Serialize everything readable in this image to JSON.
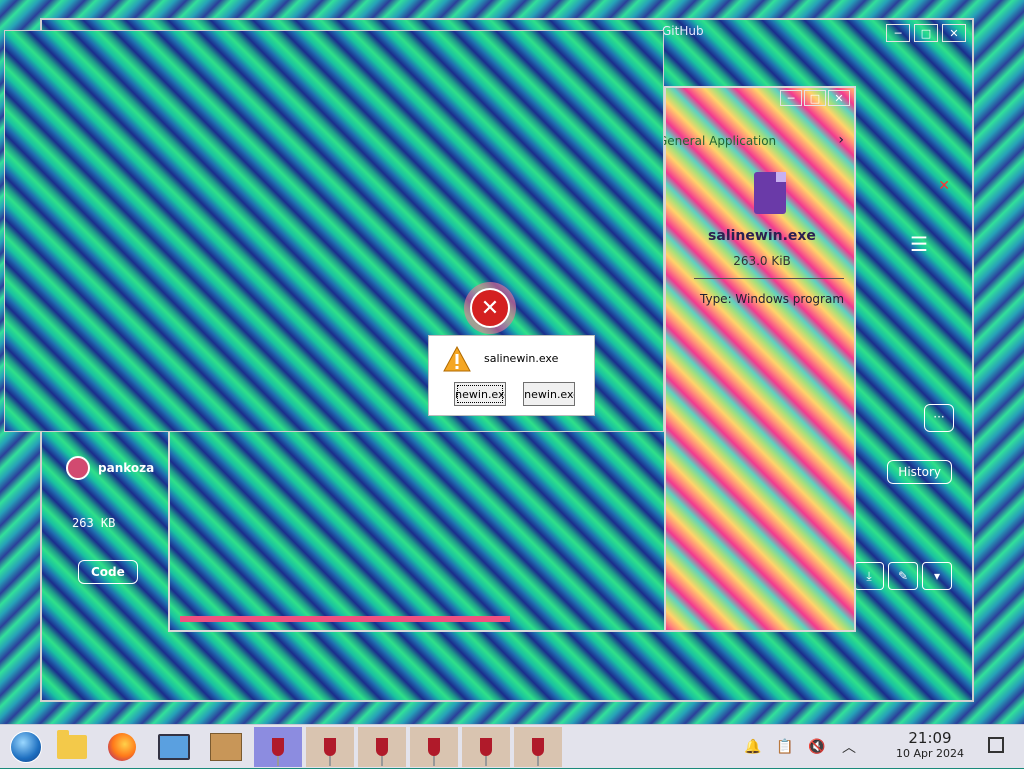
{
  "github_window": {
    "tab_label": "GitHub",
    "user": "pankoza",
    "file_size": "263 KB",
    "code_tab": "Code",
    "history_button": "History",
    "more_button": "···",
    "menu_glyph": "☰",
    "close_glyph": "✕",
    "min_glyph": "─",
    "max_glyph": "□"
  },
  "properties_window": {
    "header": "General Application",
    "chevron": "›",
    "file_name": "salinewin.exe",
    "file_size": "263.0 KiB",
    "type_line": "Type: Windows program",
    "min_glyph": "─",
    "max_glyph": "□",
    "close_glyph": "✕"
  },
  "dialog": {
    "message": "salinewin.exe",
    "button_1": "linewin.exe",
    "button_2": "linewin.exe"
  },
  "error_glyph": "✕",
  "taskbar": {
    "items": [
      {
        "name": "start-menu",
        "icon": "windows-orb-icon"
      },
      {
        "name": "file-manager",
        "icon": "folder-icon"
      },
      {
        "name": "firefox",
        "icon": "firefox-icon"
      },
      {
        "name": "system-monitor",
        "icon": "monitor-icon"
      },
      {
        "name": "archive-manager",
        "icon": "package-icon"
      },
      {
        "name": "wine-app-1",
        "icon": "wine-glass-icon"
      },
      {
        "name": "wine-app-2",
        "icon": "wine-glass-icon"
      },
      {
        "name": "wine-app-3",
        "icon": "wine-glass-icon"
      },
      {
        "name": "wine-app-4",
        "icon": "wine-glass-icon"
      },
      {
        "name": "wine-app-5",
        "icon": "wine-glass-icon"
      },
      {
        "name": "wine-app-6",
        "icon": "wine-glass-icon"
      }
    ],
    "tray": {
      "notifications_glyph": "🔔",
      "clipboard_glyph": "📋",
      "volume_glyph": "🔇",
      "expand_glyph": "︿"
    },
    "clock_time": "21:09",
    "clock_date": "10 Apr 2024"
  }
}
